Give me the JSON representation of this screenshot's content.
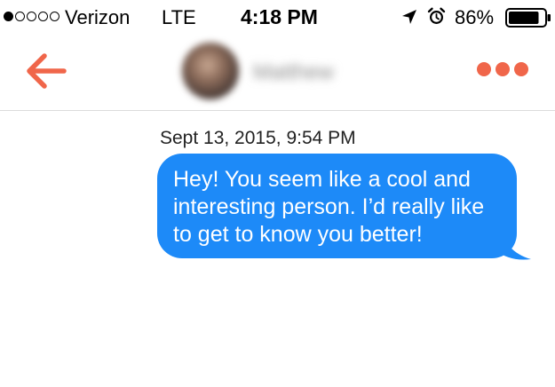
{
  "status_bar": {
    "signal_dots": [
      true,
      false,
      false,
      false,
      false
    ],
    "carrier": "Verizon",
    "network": "LTE",
    "time": "4:18 PM",
    "battery_percent": "86%",
    "battery_level": 0.86,
    "icons": [
      "location-arrow-icon",
      "alarm-clock-icon",
      "battery-icon"
    ]
  },
  "header": {
    "back_icon": "arrow-left-icon",
    "contact_name": "Matthew",
    "more_icon": "more-dots-icon",
    "accent_color": "#f0664a"
  },
  "conversation": {
    "messages": [
      {
        "timestamp": "Sept 13, 2015, 9:54 PM",
        "direction": "outgoing",
        "text": "Hey! You seem like a cool and interesting person. I’d really like to get to know you better!"
      }
    ],
    "bubble_color": "#1d8af8"
  }
}
